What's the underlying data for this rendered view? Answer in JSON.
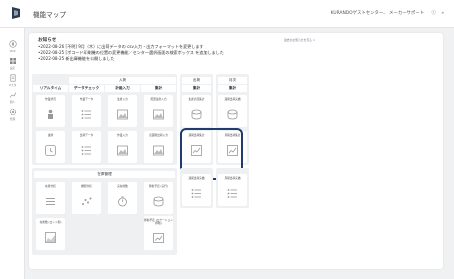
{
  "header": {
    "title": "機能マップ",
    "right_text": "KURANDOゲストセンター、 メーカーサポート"
  },
  "sidebar": {
    "items": [
      {
        "label": "MAP",
        "icon": "compass-icon"
      },
      {
        "label": "設定",
        "icon": "grid-icon"
      },
      {
        "label": "マスタ",
        "icon": "document-icon"
      },
      {
        "label": "個人",
        "icon": "chart-icon"
      },
      {
        "label": "管理",
        "icon": "gear-icon"
      }
    ]
  },
  "notice": {
    "title": "お知らせ",
    "link": "過去のお知らせを見る >",
    "items": [
      "2022-08-26 [不明] 9月（木）に出荷データの csv入力・出力フォーマットを変更します",
      "2022-08-25 [ボコード印刷機の位置の変更機能／センター選択画面の検索ボックス を追加しました",
      "2022-08-25 新出庫機能を公開しました"
    ]
  },
  "sections": {
    "nyuka": "入荷",
    "shukka": "出荷",
    "tsuki": "月次",
    "realtime": "リアルタイム",
    "data_check": "データチェック",
    "keikaku": "計画入力",
    "shukei1": "集計",
    "shukei2": "集計",
    "shukei3": "集計",
    "zaiko": "在庫管理"
  },
  "cards": {
    "c1": "作業状況",
    "c2": "作業データ",
    "c3": "生産入力",
    "c4": "配置生産入力",
    "c5": "生産計画集計",
    "c6": "週報出荷実績",
    "c7": "月報出荷実績",
    "c8": "進捗",
    "c9": "出荷データ",
    "c10": "作業入力",
    "c11": "店舗別出荷入力",
    "c12": "週報出荷集計",
    "c13": "月報出荷集計",
    "c14": "週報出荷実績",
    "c15": "月報出荷実績",
    "c16": "在庫分析",
    "c17": "棚卸分析",
    "c18": "実在庫数",
    "c19": "移動予定 (実行)",
    "c20": "移動予定 (ロケーション移動)",
    "c21": "在庫数 (ロット別)"
  }
}
